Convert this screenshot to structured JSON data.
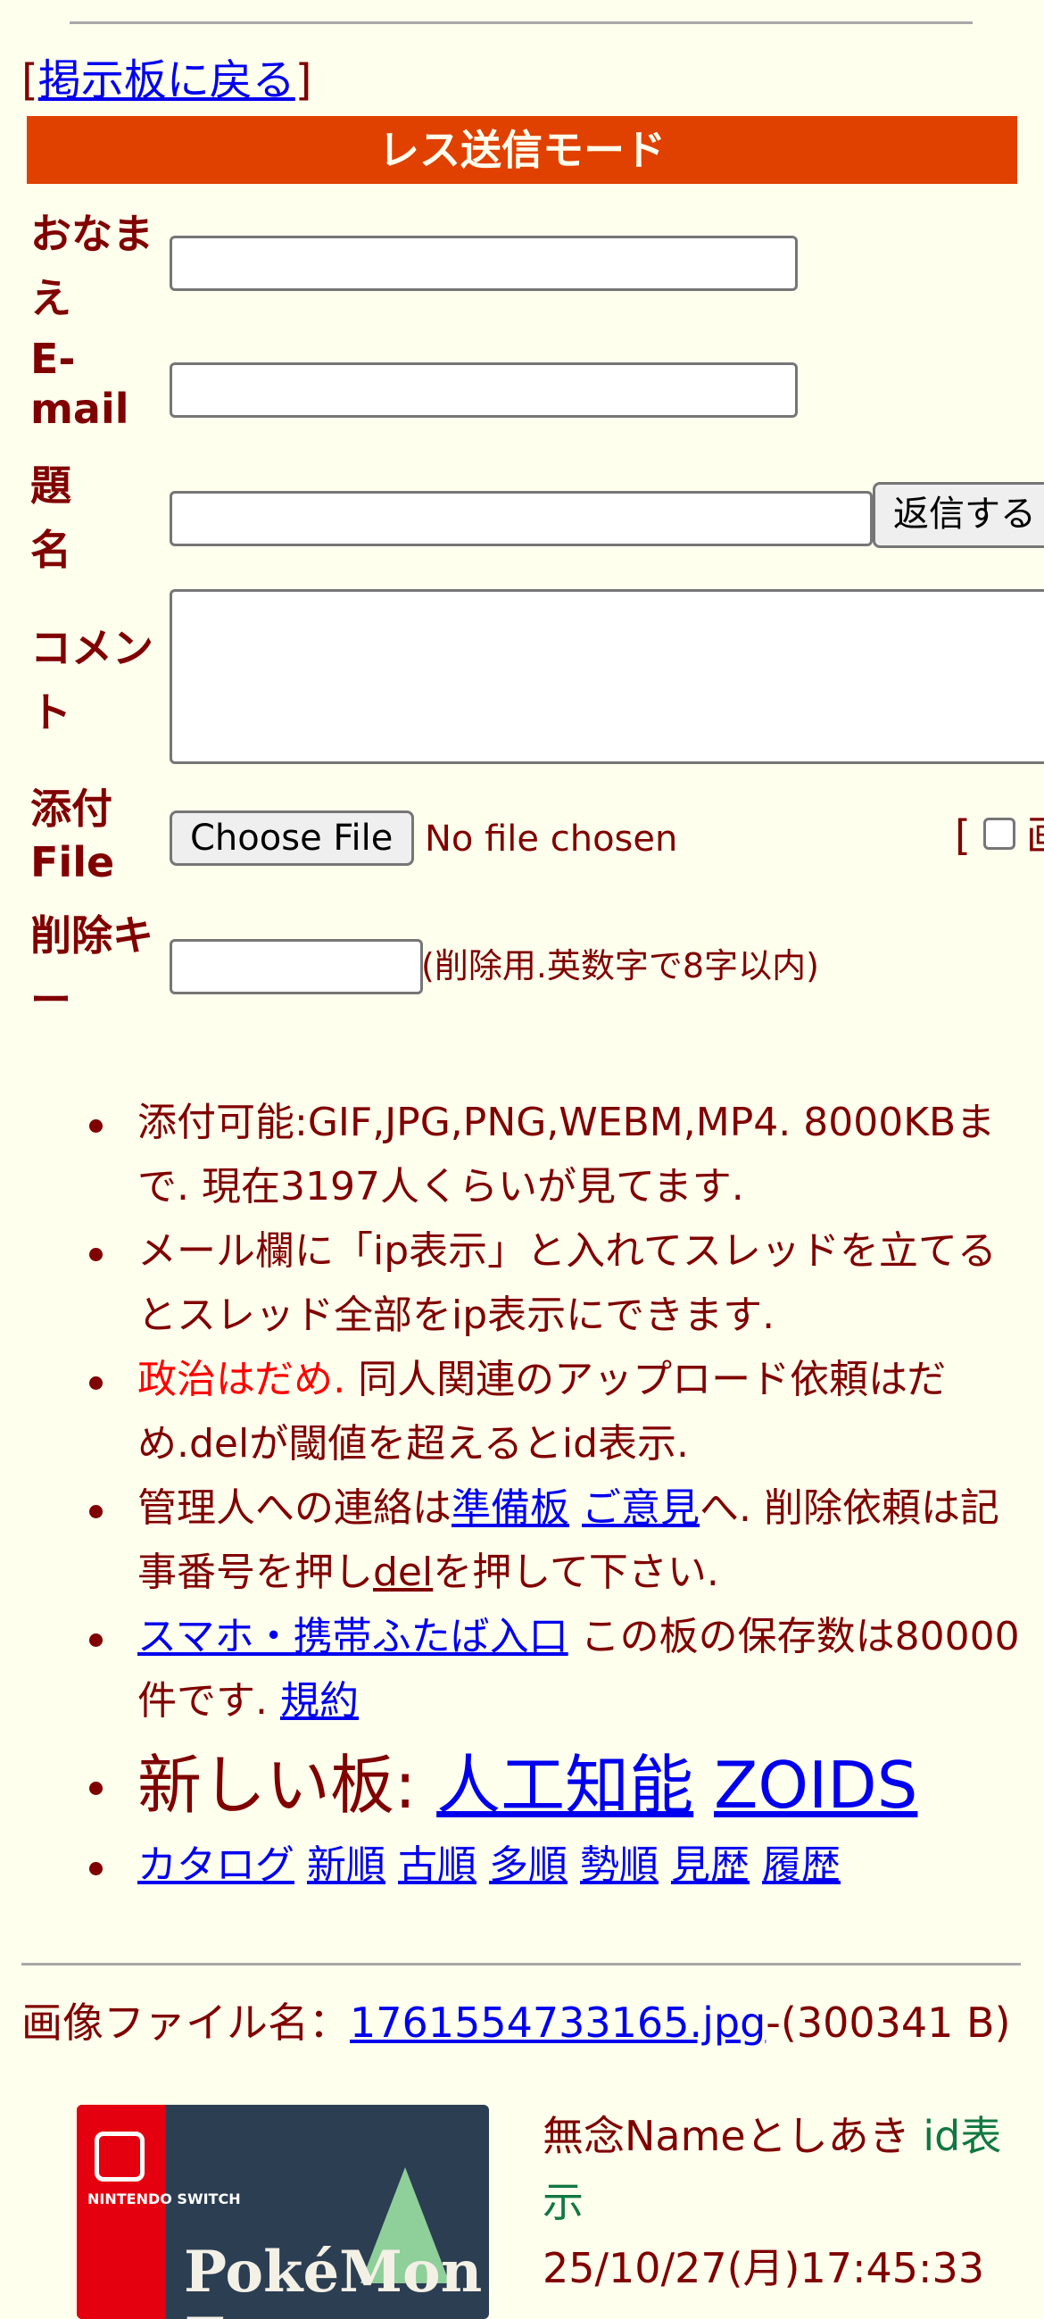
{
  "nav": {
    "back_open": "[",
    "back_label": "掲示板に戻る",
    "back_close": "]"
  },
  "form": {
    "mode_title": "レス送信モード",
    "name_label": "おなまえ",
    "email_label": "E-mail",
    "subject_label": "題名",
    "submit_label": "返信する",
    "comment_label": "コメント",
    "file_label": "添付File",
    "choose_file_label": "Choose File",
    "no_file_text": "No file chosen",
    "options_open": "[",
    "image_option_partial": "画",
    "delkey_label": "削除キー",
    "delkey_note": "(削除用.英数字で8字以内)"
  },
  "rules": {
    "r1": "添付可能:GIF,JPG,PNG,WEBM,MP4. 8000KBまで. 現在3197人くらいが見てます.",
    "r2": "メール欄に「ip表示」と入れてスレッドを立てるとスレッド全部をip表示にできます.",
    "r3_red": "政治はだめ.",
    "r3_rest": " 同人関連のアップロード依頼はだめ.delが閾値を超えるとid表示.",
    "r4_pre": "管理人への連絡は",
    "r4_link1": "準備板",
    "r4_link2": "ご意見",
    "r4_mid": "へ. 削除依頼は記事番号を押し",
    "r4_link3": "del",
    "r4_post": "を押して下さい.",
    "r5_link": "スマホ・携帯ふたば入口",
    "r5_rest": " この板の保存数は80000件です. ",
    "r5_link2": "規約",
    "r6_pre": "新しい板: ",
    "r6_link1": "人工知能",
    "r6_link2": "ZOIDS",
    "catalog": [
      "カタログ",
      "新順",
      "古順",
      "多順",
      "勢順",
      "見歴",
      "履歴"
    ]
  },
  "post": {
    "file_prefix": "画像ファイル名：",
    "file_name": "1761554733165.jpg",
    "file_size": "-(300341 B)",
    "thumb_brand": "NINTENDO SWITCH",
    "thumb_logo": "PokéMon Z",
    "name": "無念Nameとしあき",
    "id_label": "id表示",
    "date": "25/10/27(月)17:45:33"
  }
}
